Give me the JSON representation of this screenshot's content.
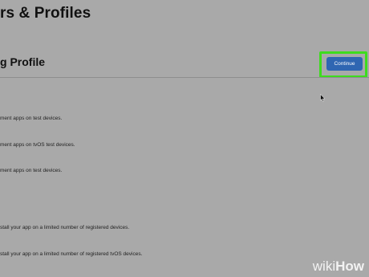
{
  "header": {
    "page_title": "rs & Profiles"
  },
  "section": {
    "title": "g Profile",
    "continue_label": "Continue"
  },
  "options": [
    {
      "description": "ment apps on test devices."
    },
    {
      "description": "ment apps on tvOS test devices."
    },
    {
      "description": "ment apps on test devices."
    },
    {
      "description": "stall your app on a limited number of registered devices."
    },
    {
      "description": "stall your app on a limited number of registered tvOS devices."
    }
  ],
  "watermark": {
    "wiki": "wiki",
    "how": "How"
  },
  "colors": {
    "background": "#a9a9a9",
    "button": "#2f66b2",
    "highlight": "#3ddc1e"
  }
}
